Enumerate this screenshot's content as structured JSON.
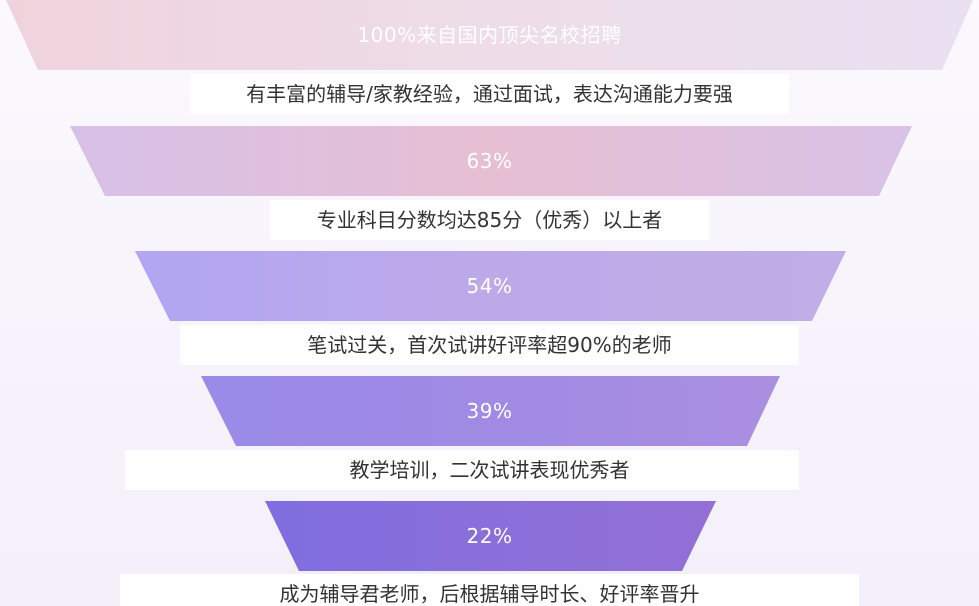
{
  "funnel": {
    "stages": [
      {
        "label": "100%来自国内顶尖名校招聘",
        "description": "有丰富的辅导/家教经验，通过面试，表达沟通能力要强",
        "colors": [
          "#efd3dc",
          "#eedde8",
          "#e9e0f2"
        ]
      },
      {
        "label": "63%",
        "description": "专业科目分数均达85分（优秀）以上者",
        "colors": [
          "#d7c0e8",
          "#e6bfd3",
          "#d9c2e6"
        ]
      },
      {
        "label": "54%",
        "description": "笔试过关，首次试讲好评率超90%的老师",
        "colors": [
          "#b1a6f2",
          "#bda9e8",
          "#c0aee6"
        ]
      },
      {
        "label": "39%",
        "description": "教学培训，二次试讲表现优秀者",
        "colors": [
          "#998be8",
          "#a08ae4",
          "#ab8fe1"
        ]
      },
      {
        "label": "22%",
        "description": "成为辅导君老师，后根据辅导时长、好评率晋升",
        "colors": [
          "#7f6ee0",
          "#8a6fda",
          "#936fd6"
        ]
      }
    ]
  }
}
